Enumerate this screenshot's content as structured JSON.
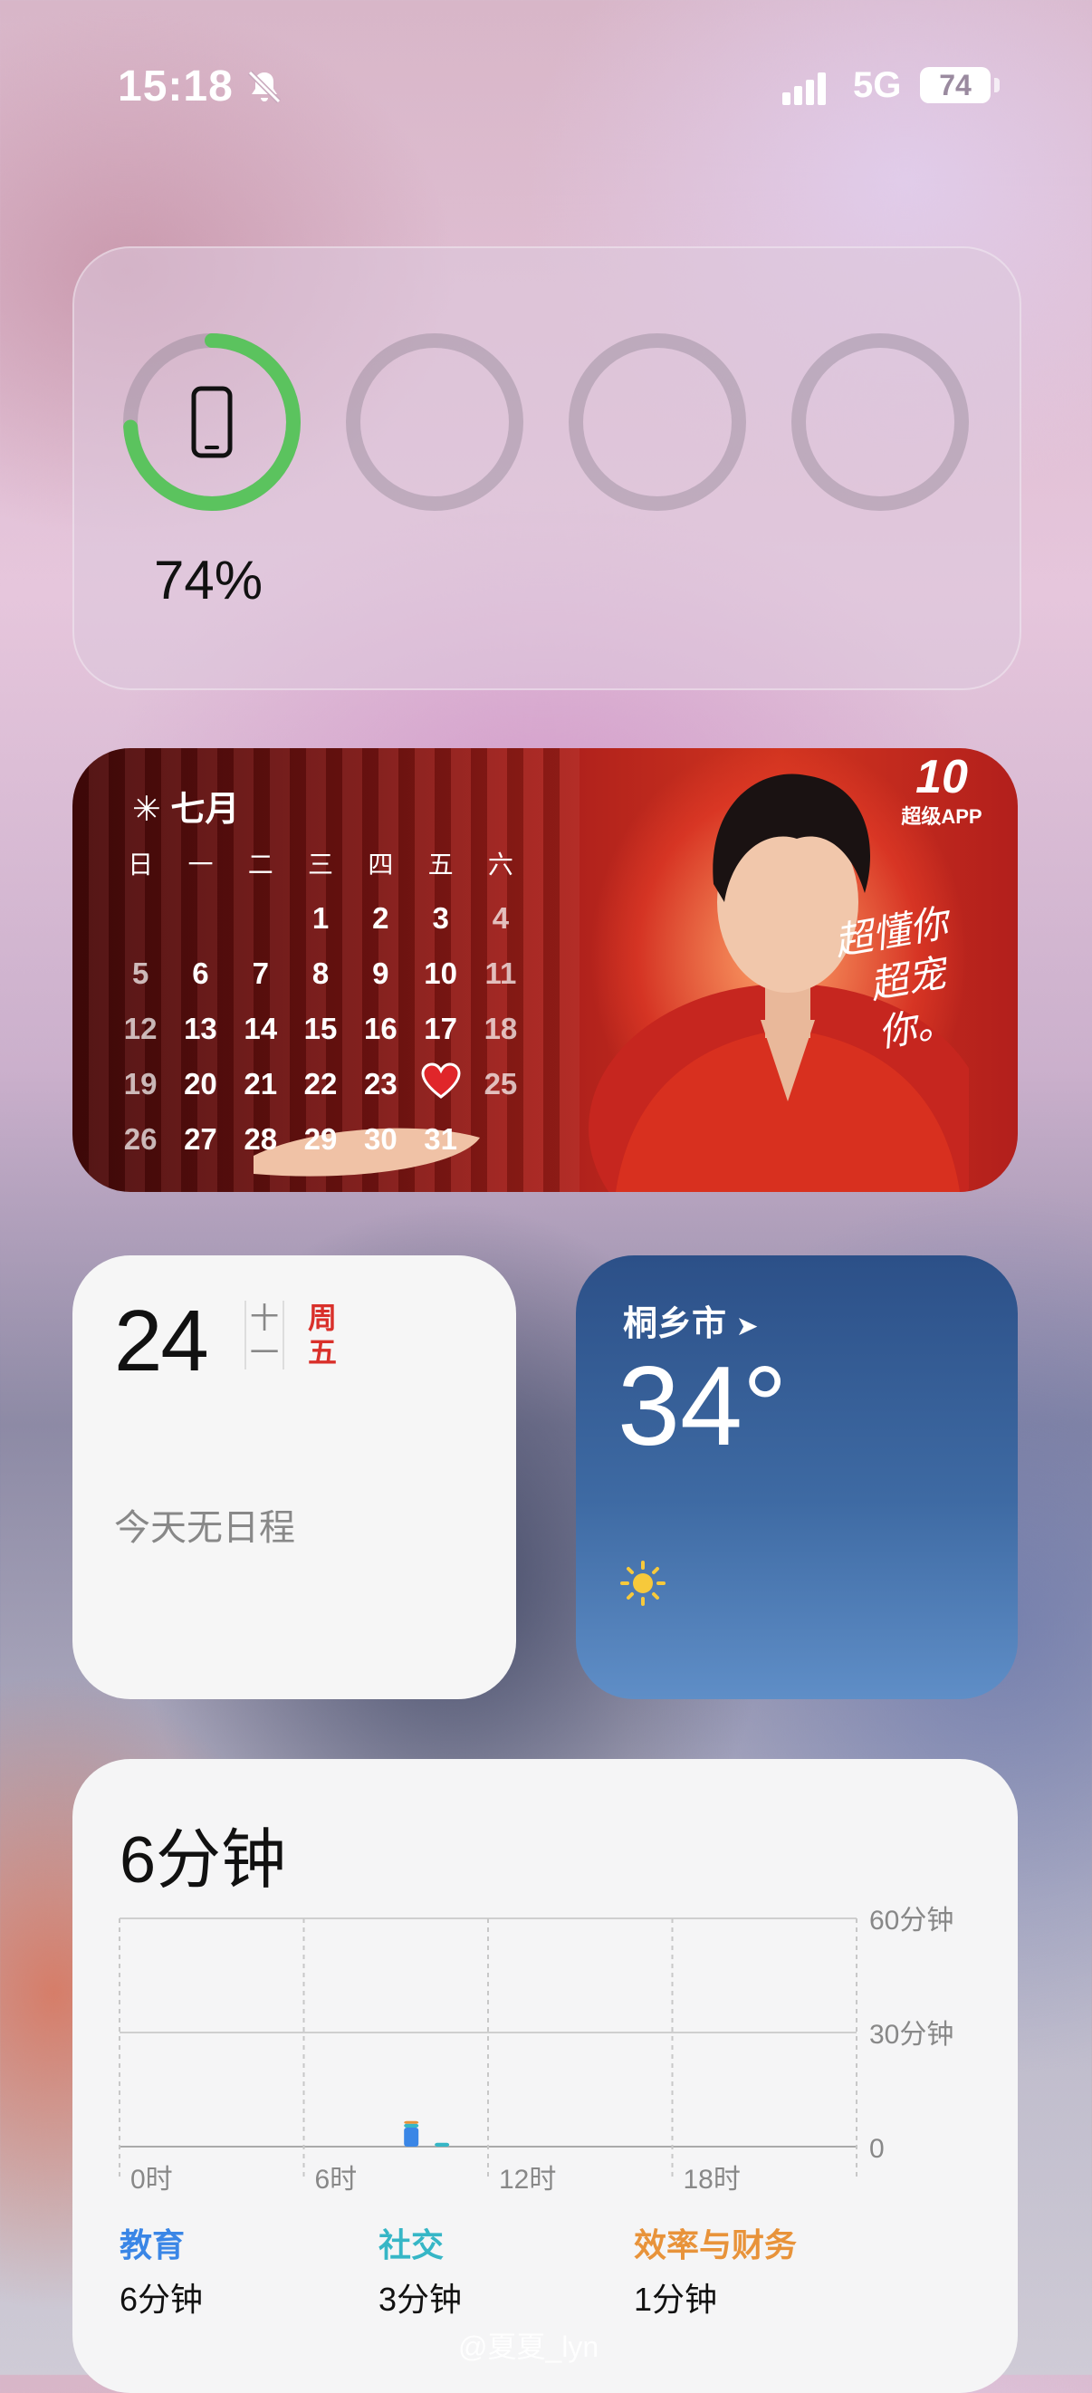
{
  "status_bar": {
    "time": "15:18",
    "network": "5G",
    "battery": "74"
  },
  "battery_widget": {
    "percent_label": "74%",
    "level": 0.74,
    "ring_color": "#5bc35e"
  },
  "photo_calendar": {
    "month": "七月",
    "weekdays": [
      "日",
      "一",
      "二",
      "三",
      "四",
      "五",
      "六"
    ],
    "weeks": [
      [
        "",
        "",
        "",
        "1",
        "2",
        "3",
        "4"
      ],
      [
        "5",
        "6",
        "7",
        "8",
        "9",
        "10",
        "11"
      ],
      [
        "12",
        "13",
        "14",
        "15",
        "16",
        "17",
        "18"
      ],
      [
        "19",
        "20",
        "21",
        "22",
        "23",
        "",
        "25"
      ],
      [
        "26",
        "27",
        "28",
        "29",
        "30",
        "31",
        ""
      ]
    ],
    "slogan_line1": "超懂你",
    "slogan_line2": "超宠你。",
    "logo_text": "超级APP",
    "logo_number": "10"
  },
  "calendar_widget": {
    "day": "24",
    "lunar_1": "十",
    "lunar_2": "一",
    "weekday_1": "周",
    "weekday_2": "五",
    "empty_text": "今天无日程"
  },
  "weather_widget": {
    "city": "桐乡市",
    "temperature": "34°"
  },
  "screen_time": {
    "total": "6分钟",
    "y_labels": [
      "60分钟",
      "30分钟",
      "0"
    ],
    "x_labels": [
      "0时",
      "6时",
      "12时",
      "18时"
    ],
    "categories": [
      {
        "name": "教育",
        "value": "6分钟",
        "color": "#3a86e6"
      },
      {
        "name": "社交",
        "value": "3分钟",
        "color": "#36b6c6"
      },
      {
        "name": "效率与财务",
        "value": "1分钟",
        "color": "#e8933a"
      }
    ]
  },
  "chart_data": {
    "type": "bar",
    "title": "6分钟",
    "x": [
      "0时",
      "6时",
      "12时",
      "18时"
    ],
    "ylim": [
      0,
      60
    ],
    "y_ticks": [
      "60分钟",
      "30分钟",
      "0"
    ],
    "series": [
      {
        "name": "教育",
        "bars": [
          {
            "hour": 9.5,
            "value": 5
          }
        ]
      },
      {
        "name": "社交",
        "bars": [
          {
            "hour": 9.5,
            "value": 1
          },
          {
            "hour": 10.5,
            "value": 1
          }
        ]
      },
      {
        "name": "效率与财务",
        "bars": [
          {
            "hour": 9.5,
            "value": 0.5
          }
        ]
      }
    ]
  },
  "watermark": "@夏夏_lyn"
}
